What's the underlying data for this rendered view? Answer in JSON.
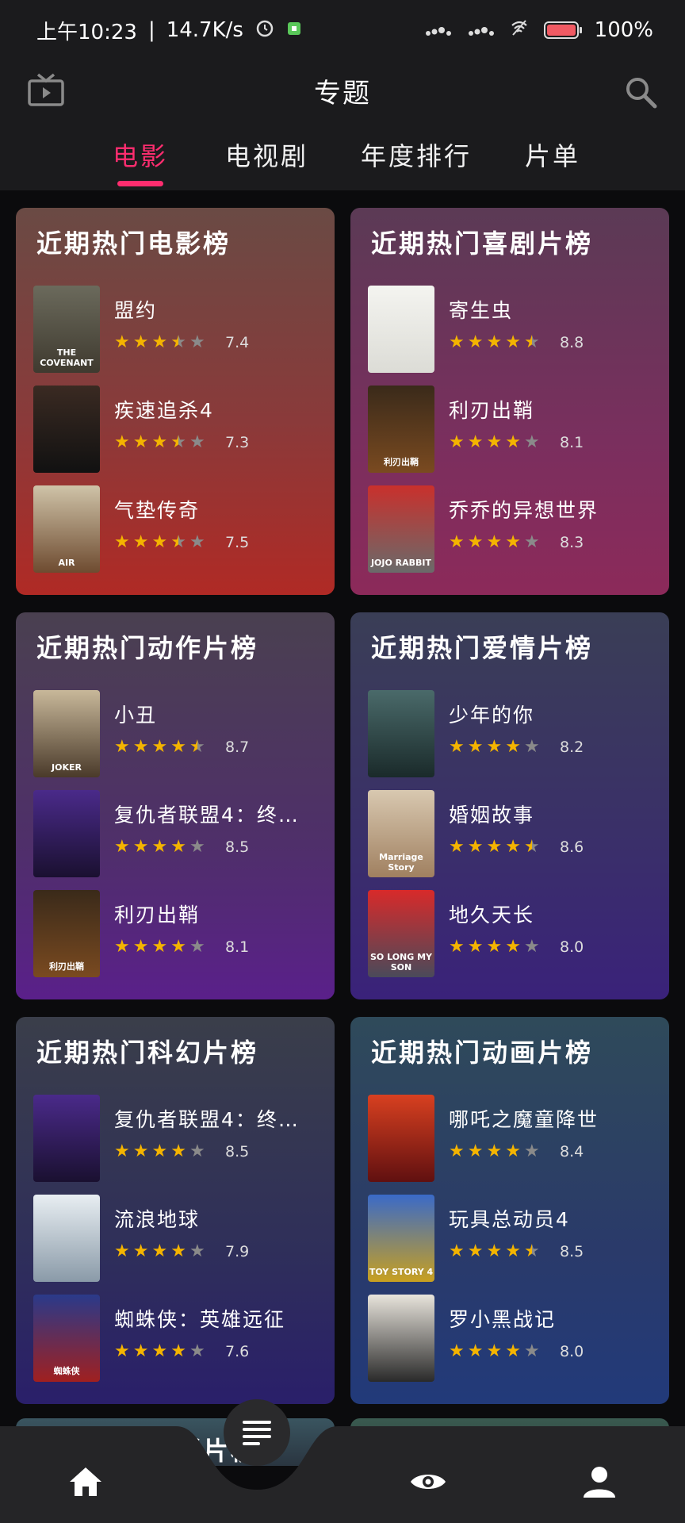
{
  "status_bar": {
    "time": "上午10:23",
    "speed": "14.7K/s",
    "battery": "100%"
  },
  "header": {
    "title": "专题",
    "tabs": [
      {
        "label": "电影",
        "active": true
      },
      {
        "label": "电视剧",
        "active": false
      },
      {
        "label": "年度排行",
        "active": false
      },
      {
        "label": "片单",
        "active": false
      }
    ]
  },
  "accent_color": "#ff2d6f",
  "star_color": "#f4b400",
  "cards": [
    {
      "title": "近期热门电影榜",
      "bg": "linear-gradient(180deg,#6a4a44 0%,#8a3a3a 55%,#b02a25 100%)",
      "items": [
        {
          "name": "盟约",
          "rating": "7.4",
          "stars": 3.5,
          "poster_bg": "linear-gradient(180deg,#6b6a5c,#3f3a2f)",
          "poster_text": "THE COVENANT"
        },
        {
          "name": "疾速追杀4",
          "rating": "7.3",
          "stars": 3.5,
          "poster_bg": "linear-gradient(180deg,#3a2a22,#111)",
          "poster_text": ""
        },
        {
          "name": "气垫传奇",
          "rating": "7.5",
          "stars": 3.5,
          "poster_bg": "linear-gradient(180deg,#cfc3a8,#6e4b30)",
          "poster_text": "AIR"
        }
      ]
    },
    {
      "title": "近期热门喜剧片榜",
      "bg": "linear-gradient(180deg,#5b3a55 0%,#7a2f5e 60%,#8c2a5a 100%)",
      "items": [
        {
          "name": "寄生虫",
          "rating": "8.8",
          "stars": 4.5,
          "poster_bg": "linear-gradient(180deg,#f4f4f0,#dcdcd6)",
          "poster_text": ""
        },
        {
          "name": "利刃出鞘",
          "rating": "8.1",
          "stars": 4,
          "poster_bg": "linear-gradient(180deg,#3a2a1a,#7a4a20)",
          "poster_text": "利刃出鞘"
        },
        {
          "name": "乔乔的异想世界",
          "rating": "8.3",
          "stars": 4,
          "poster_bg": "linear-gradient(180deg,#c9302c,#6a6a6a)",
          "poster_text": "JOJO RABBIT"
        }
      ]
    },
    {
      "title": "近期热门动作片榜",
      "bg": "linear-gradient(180deg,#4a4050 0%,#4f2f6a 60%,#5a208a 100%)",
      "items": [
        {
          "name": "小丑",
          "rating": "8.7",
          "stars": 4.5,
          "poster_bg": "linear-gradient(180deg,#c8b89a,#4a3a2a)",
          "poster_text": "JOKER"
        },
        {
          "name": "复仇者联盟4：终…",
          "rating": "8.5",
          "stars": 4,
          "poster_bg": "linear-gradient(180deg,#4a2a8a,#1a1030)",
          "poster_text": ""
        },
        {
          "name": "利刃出鞘",
          "rating": "8.1",
          "stars": 4,
          "poster_bg": "linear-gradient(180deg,#3a2a1a,#7a4a20)",
          "poster_text": "利刃出鞘"
        }
      ]
    },
    {
      "title": "近期热门爱情片榜",
      "bg": "linear-gradient(180deg,#3a3e56 0%,#3a2f6a 60%,#3a227a 100%)",
      "items": [
        {
          "name": "少年的你",
          "rating": "8.2",
          "stars": 4,
          "poster_bg": "linear-gradient(180deg,#4a6a6a,#1a2a2a)",
          "poster_text": ""
        },
        {
          "name": "婚姻故事",
          "rating": "8.6",
          "stars": 4.5,
          "poster_bg": "linear-gradient(180deg,#d8c8b0,#a08060)",
          "poster_text": "Marriage Story"
        },
        {
          "name": "地久天长",
          "rating": "8.0",
          "stars": 4,
          "poster_bg": "linear-gradient(180deg,#d82a2a,#4a4a5a)",
          "poster_text": "SO LONG MY SON"
        }
      ]
    },
    {
      "title": "近期热门科幻片榜",
      "bg": "linear-gradient(180deg,#3a3e4a 0%,#2f2f5a 60%,#2a1f6a 100%)",
      "items": [
        {
          "name": "复仇者联盟4：终…",
          "rating": "8.5",
          "stars": 4,
          "poster_bg": "linear-gradient(180deg,#4a2a8a,#1a1030)",
          "poster_text": ""
        },
        {
          "name": "流浪地球",
          "rating": "7.9",
          "stars": 4,
          "poster_bg": "linear-gradient(180deg,#e8eef2,#8a9aa8)",
          "poster_text": ""
        },
        {
          "name": "蜘蛛侠：英雄远征",
          "rating": "7.6",
          "stars": 4,
          "poster_bg": "linear-gradient(180deg,#2a3a8a,#a02020)",
          "poster_text": "蜘蛛侠"
        }
      ]
    },
    {
      "title": "近期热门动画片榜",
      "bg": "linear-gradient(180deg,#2f4a5a 0%,#2a3a6a 60%,#223a7a 100%)",
      "items": [
        {
          "name": "哪吒之魔童降世",
          "rating": "8.4",
          "stars": 4,
          "poster_bg": "linear-gradient(180deg,#d84020,#601010)",
          "poster_text": ""
        },
        {
          "name": "玩具总动员4",
          "rating": "8.5",
          "stars": 4.5,
          "poster_bg": "linear-gradient(180deg,#3a6ac8,#c8a020)",
          "poster_text": "TOY STORY 4"
        },
        {
          "name": "罗小黑战记",
          "rating": "8.0",
          "stars": 4,
          "poster_bg": "linear-gradient(180deg,#e8e4dc,#2a2a2a)",
          "poster_text": ""
        }
      ]
    }
  ],
  "partial_cards": [
    {
      "title": "近期热门悬疑片榜",
      "bg": "linear-gradient(180deg,#3a5560,#2a3540)"
    },
    {
      "title": "",
      "bg": "linear-gradient(180deg,#3a5a50,#2a4038)"
    }
  ],
  "bottom_nav": {
    "bg": "#252527",
    "items": [
      "home-icon",
      "menu-icon",
      "eye-icon",
      "profile-icon"
    ]
  }
}
